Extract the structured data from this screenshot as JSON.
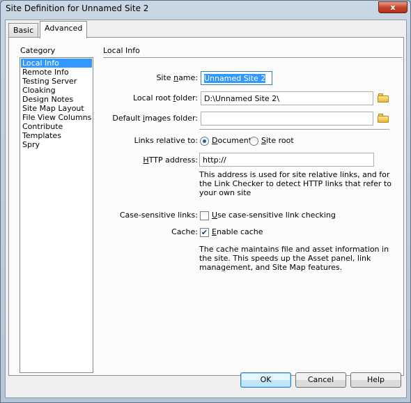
{
  "window": {
    "title": "Site Definition for Unnamed Site 2",
    "close_glyph": "x"
  },
  "tabs": {
    "basic": "Basic",
    "advanced": "Advanced"
  },
  "category": {
    "label": "Category",
    "items": [
      "Local Info",
      "Remote Info",
      "Testing Server",
      "Cloaking",
      "Design Notes",
      "Site Map Layout",
      "File View Columns",
      "Contribute",
      "Templates",
      "Spry"
    ]
  },
  "local_info": {
    "section_title": "Local Info",
    "site_name_pre": "Site ",
    "site_name_acc": "n",
    "site_name_post": "ame:",
    "site_name_value": "Unnamed Site 2",
    "root_pre": "Local root ",
    "root_acc": "f",
    "root_post": "older:",
    "root_value": "D:\\Unnamed Site 2\\",
    "images_pre": "Default ",
    "images_acc": "i",
    "images_post": "mages folder:",
    "images_value": "",
    "links_label": "Links relative to:",
    "doc_pre": "",
    "doc_acc": "D",
    "doc_post": "ocument",
    "root_opt_pre": "",
    "root_opt_acc": "S",
    "root_opt_post": "ite root",
    "http_pre": "",
    "http_acc": "H",
    "http_post": "TTP address:",
    "http_value": "http://",
    "http_help": [
      "This address is used for site relative links, and for",
      "the Link Checker to detect HTTP links that refer to",
      "your own site"
    ],
    "case_label": "Case-sensitive links:",
    "case_pre": "",
    "case_acc": "U",
    "case_post": "se case-sensitive link checking",
    "cache_label": "Cache:",
    "cache_pre": "",
    "cache_acc": "E",
    "cache_post": "nable cache",
    "cache_checked": "✔",
    "cache_help": [
      "The cache maintains file and asset information in",
      "the site.  This speeds up the Asset panel, link",
      "management, and Site Map features."
    ]
  },
  "buttons": {
    "ok": "OK",
    "cancel": "Cancel",
    "help": "Help"
  }
}
